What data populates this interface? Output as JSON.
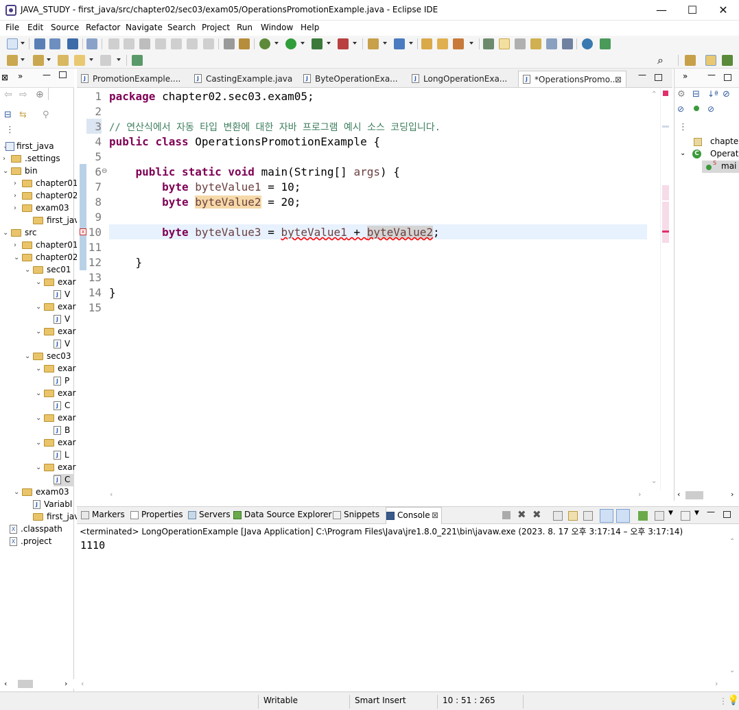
{
  "window": {
    "title": "JAVA_STUDY - first_java/src/chapter02/sec03/exam05/OperationsPromotionExample.java - Eclipse IDE",
    "minimize": "—",
    "maximize": "☐",
    "close": "✕"
  },
  "menu": [
    "File",
    "Edit",
    "Source",
    "Refactor",
    "Navigate",
    "Search",
    "Project",
    "Run",
    "Window",
    "Help"
  ],
  "package_explorer": {
    "items": [
      {
        "label": "first_java",
        "type": "project",
        "arrow": "⌄"
      },
      {
        "label": ".settings",
        "type": "folder",
        "arrow": "›"
      },
      {
        "label": "bin",
        "type": "folder",
        "arrow": "⌄"
      },
      {
        "label": "chapter01",
        "type": "folder",
        "arrow": "›"
      },
      {
        "label": "chapter02",
        "type": "folder",
        "arrow": "›"
      },
      {
        "label": "exam03",
        "type": "folder",
        "arrow": "›"
      },
      {
        "label": "first_java",
        "type": "folder",
        "arrow": ""
      },
      {
        "label": "src",
        "type": "folder",
        "arrow": "⌄"
      },
      {
        "label": "chapter01",
        "type": "folder",
        "arrow": "›"
      },
      {
        "label": "chapter02",
        "type": "folder",
        "arrow": "⌄"
      },
      {
        "label": "sec01",
        "type": "folder",
        "arrow": "⌄"
      },
      {
        "label": "exar",
        "type": "folder",
        "arrow": "⌄"
      },
      {
        "label": "V",
        "type": "java",
        "arrow": ""
      },
      {
        "label": "exar",
        "type": "folder",
        "arrow": "⌄"
      },
      {
        "label": "V",
        "type": "java",
        "arrow": ""
      },
      {
        "label": "exar",
        "type": "folder",
        "arrow": "⌄"
      },
      {
        "label": "V",
        "type": "java",
        "arrow": ""
      },
      {
        "label": "sec03",
        "type": "folder",
        "arrow": "⌄"
      },
      {
        "label": "exar",
        "type": "folder",
        "arrow": "⌄"
      },
      {
        "label": "P",
        "type": "java",
        "arrow": ""
      },
      {
        "label": "exar",
        "type": "folder",
        "arrow": "⌄"
      },
      {
        "label": "C",
        "type": "java",
        "arrow": ""
      },
      {
        "label": "exar",
        "type": "folder",
        "arrow": "⌄"
      },
      {
        "label": "B",
        "type": "java",
        "arrow": ""
      },
      {
        "label": "exar",
        "type": "folder",
        "arrow": "⌄"
      },
      {
        "label": "L",
        "type": "java",
        "arrow": ""
      },
      {
        "label": "exar",
        "type": "folder",
        "arrow": "⌄"
      },
      {
        "label": "C",
        "type": "java",
        "arrow": ""
      },
      {
        "label": "exam03",
        "type": "folder",
        "arrow": "⌄"
      },
      {
        "label": "Variabl",
        "type": "java",
        "arrow": ""
      },
      {
        "label": "first_java",
        "type": "folder",
        "arrow": ""
      },
      {
        "label": ".classpath",
        "type": "xml",
        "arrow": ""
      },
      {
        "label": ".project",
        "type": "xml",
        "arrow": ""
      }
    ]
  },
  "editor_tabs": [
    {
      "label": "PromotionExample...."
    },
    {
      "label": "CastingExample.java"
    },
    {
      "label": "ByteOperationExa..."
    },
    {
      "label": "LongOperationExa..."
    },
    {
      "label": "*OperationsPromo..."
    }
  ],
  "code": {
    "line_numbers": [
      "1",
      "2",
      "3",
      "4",
      "5",
      "6",
      "7",
      "8",
      "9",
      "10",
      "11",
      "12",
      "13",
      "14",
      "15"
    ],
    "l1_kw": "package",
    "l1_rest": " chapter02.sec03.exam05;",
    "l3": "// 연산식에서 자동 타입 변환에 대한 자바 프로그램 예시 소스 코딩입니다.",
    "l4_kw1": "public",
    "l4_kw2": "class",
    "l4_rest": " OperationsPromotionExample {",
    "l6_kw1": "public",
    "l6_kw2": "static",
    "l6_kw3": "void",
    "l6_rest": " main(String[] ",
    "l6_args": "args",
    "l6_end": ") {",
    "l7_kw": "byte",
    "l7_var": "byteValue1",
    "l7_rest": " = 10;",
    "l8_kw": "byte",
    "l8_var": "byteValue2",
    "l8_rest": " = 20;",
    "l10_kw": "byte",
    "l10_var": "byteValue3",
    "l10_eq": " = ",
    "l10_a": "byteValue1",
    "l10_plus": " + ",
    "l10_b": "byteValue2",
    "l10_end": ";",
    "l12": "}",
    "l14": "}"
  },
  "outline": {
    "item1": "chapter",
    "item2": "Operati",
    "item3": "mai"
  },
  "console_tabs": [
    {
      "label": "Markers",
      "icon": "markers-icon"
    },
    {
      "label": "Properties",
      "icon": "properties-icon"
    },
    {
      "label": "Servers",
      "icon": "servers-icon"
    },
    {
      "label": "Data Source Explorer",
      "icon": "data-source-icon"
    },
    {
      "label": "Snippets",
      "icon": "snippets-icon"
    },
    {
      "label": "Console",
      "icon": "console-icon"
    }
  ],
  "console": {
    "status": "<terminated> LongOperationExample [Java Application] C:\\Program Files\\Java\\jre1.8.0_221\\bin\\javaw.exe  (2023. 8. 17 오후 3:17:14 – 오후 3:17:14)",
    "output": "1110"
  },
  "statusbar": {
    "writable": "Writable",
    "insert_mode": "Smart Insert",
    "position": "10 : 51 : 265"
  }
}
